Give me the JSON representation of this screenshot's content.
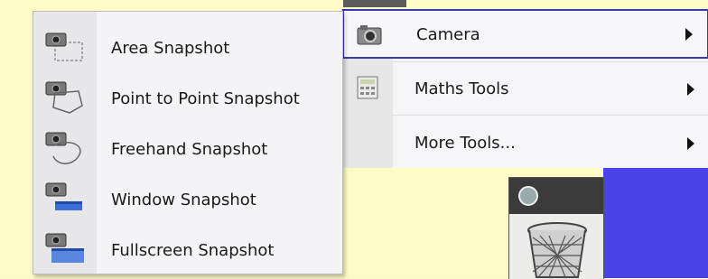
{
  "submenu": {
    "items": [
      {
        "label": "Area Snapshot",
        "icon": "area-snapshot-icon"
      },
      {
        "label": "Point to Point Snapshot",
        "icon": "point-to-point-snapshot-icon"
      },
      {
        "label": "Freehand Snapshot",
        "icon": "freehand-snapshot-icon"
      },
      {
        "label": "Window Snapshot",
        "icon": "window-snapshot-icon"
      },
      {
        "label": "Fullscreen Snapshot",
        "icon": "fullscreen-snapshot-icon"
      }
    ]
  },
  "menu": {
    "items": [
      {
        "label": "Camera",
        "icon": "camera-icon",
        "selected": true
      },
      {
        "label": "Maths Tools",
        "icon": "calculator-icon"
      },
      {
        "label": "More Tools...",
        "icon": ""
      }
    ]
  },
  "colors": {
    "desktop": "#fdfac6",
    "selection_border": "#3a3ab0",
    "blue_panel": "#4a44e6"
  },
  "widgets": {
    "trash_icon": "trash-icon"
  }
}
